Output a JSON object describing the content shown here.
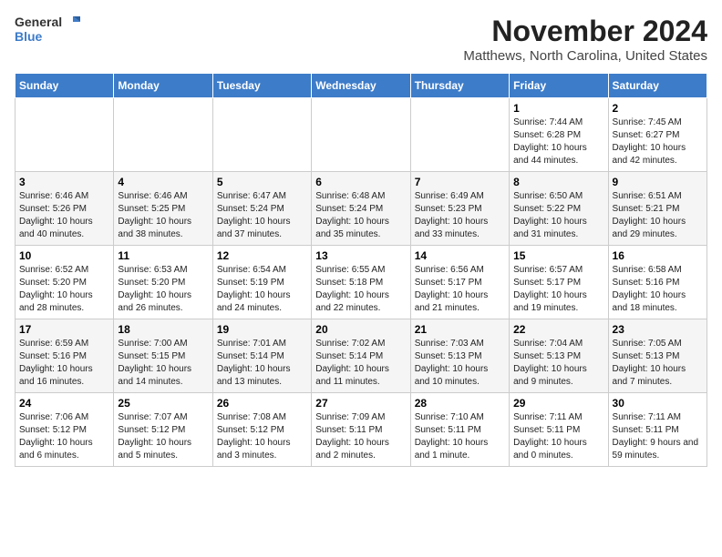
{
  "header": {
    "logo_line1": "General",
    "logo_line2": "Blue",
    "main_title": "November 2024",
    "sub_title": "Matthews, North Carolina, United States"
  },
  "days_of_week": [
    "Sunday",
    "Monday",
    "Tuesday",
    "Wednesday",
    "Thursday",
    "Friday",
    "Saturday"
  ],
  "weeks": [
    [
      {
        "day": "",
        "info": ""
      },
      {
        "day": "",
        "info": ""
      },
      {
        "day": "",
        "info": ""
      },
      {
        "day": "",
        "info": ""
      },
      {
        "day": "",
        "info": ""
      },
      {
        "day": "1",
        "info": "Sunrise: 7:44 AM\nSunset: 6:28 PM\nDaylight: 10 hours and 44 minutes."
      },
      {
        "day": "2",
        "info": "Sunrise: 7:45 AM\nSunset: 6:27 PM\nDaylight: 10 hours and 42 minutes."
      }
    ],
    [
      {
        "day": "3",
        "info": "Sunrise: 6:46 AM\nSunset: 5:26 PM\nDaylight: 10 hours and 40 minutes."
      },
      {
        "day": "4",
        "info": "Sunrise: 6:46 AM\nSunset: 5:25 PM\nDaylight: 10 hours and 38 minutes."
      },
      {
        "day": "5",
        "info": "Sunrise: 6:47 AM\nSunset: 5:24 PM\nDaylight: 10 hours and 37 minutes."
      },
      {
        "day": "6",
        "info": "Sunrise: 6:48 AM\nSunset: 5:24 PM\nDaylight: 10 hours and 35 minutes."
      },
      {
        "day": "7",
        "info": "Sunrise: 6:49 AM\nSunset: 5:23 PM\nDaylight: 10 hours and 33 minutes."
      },
      {
        "day": "8",
        "info": "Sunrise: 6:50 AM\nSunset: 5:22 PM\nDaylight: 10 hours and 31 minutes."
      },
      {
        "day": "9",
        "info": "Sunrise: 6:51 AM\nSunset: 5:21 PM\nDaylight: 10 hours and 29 minutes."
      }
    ],
    [
      {
        "day": "10",
        "info": "Sunrise: 6:52 AM\nSunset: 5:20 PM\nDaylight: 10 hours and 28 minutes."
      },
      {
        "day": "11",
        "info": "Sunrise: 6:53 AM\nSunset: 5:20 PM\nDaylight: 10 hours and 26 minutes."
      },
      {
        "day": "12",
        "info": "Sunrise: 6:54 AM\nSunset: 5:19 PM\nDaylight: 10 hours and 24 minutes."
      },
      {
        "day": "13",
        "info": "Sunrise: 6:55 AM\nSunset: 5:18 PM\nDaylight: 10 hours and 22 minutes."
      },
      {
        "day": "14",
        "info": "Sunrise: 6:56 AM\nSunset: 5:17 PM\nDaylight: 10 hours and 21 minutes."
      },
      {
        "day": "15",
        "info": "Sunrise: 6:57 AM\nSunset: 5:17 PM\nDaylight: 10 hours and 19 minutes."
      },
      {
        "day": "16",
        "info": "Sunrise: 6:58 AM\nSunset: 5:16 PM\nDaylight: 10 hours and 18 minutes."
      }
    ],
    [
      {
        "day": "17",
        "info": "Sunrise: 6:59 AM\nSunset: 5:16 PM\nDaylight: 10 hours and 16 minutes."
      },
      {
        "day": "18",
        "info": "Sunrise: 7:00 AM\nSunset: 5:15 PM\nDaylight: 10 hours and 14 minutes."
      },
      {
        "day": "19",
        "info": "Sunrise: 7:01 AM\nSunset: 5:14 PM\nDaylight: 10 hours and 13 minutes."
      },
      {
        "day": "20",
        "info": "Sunrise: 7:02 AM\nSunset: 5:14 PM\nDaylight: 10 hours and 11 minutes."
      },
      {
        "day": "21",
        "info": "Sunrise: 7:03 AM\nSunset: 5:13 PM\nDaylight: 10 hours and 10 minutes."
      },
      {
        "day": "22",
        "info": "Sunrise: 7:04 AM\nSunset: 5:13 PM\nDaylight: 10 hours and 9 minutes."
      },
      {
        "day": "23",
        "info": "Sunrise: 7:05 AM\nSunset: 5:13 PM\nDaylight: 10 hours and 7 minutes."
      }
    ],
    [
      {
        "day": "24",
        "info": "Sunrise: 7:06 AM\nSunset: 5:12 PM\nDaylight: 10 hours and 6 minutes."
      },
      {
        "day": "25",
        "info": "Sunrise: 7:07 AM\nSunset: 5:12 PM\nDaylight: 10 hours and 5 minutes."
      },
      {
        "day": "26",
        "info": "Sunrise: 7:08 AM\nSunset: 5:12 PM\nDaylight: 10 hours and 3 minutes."
      },
      {
        "day": "27",
        "info": "Sunrise: 7:09 AM\nSunset: 5:11 PM\nDaylight: 10 hours and 2 minutes."
      },
      {
        "day": "28",
        "info": "Sunrise: 7:10 AM\nSunset: 5:11 PM\nDaylight: 10 hours and 1 minute."
      },
      {
        "day": "29",
        "info": "Sunrise: 7:11 AM\nSunset: 5:11 PM\nDaylight: 10 hours and 0 minutes."
      },
      {
        "day": "30",
        "info": "Sunrise: 7:11 AM\nSunset: 5:11 PM\nDaylight: 9 hours and 59 minutes."
      }
    ]
  ]
}
